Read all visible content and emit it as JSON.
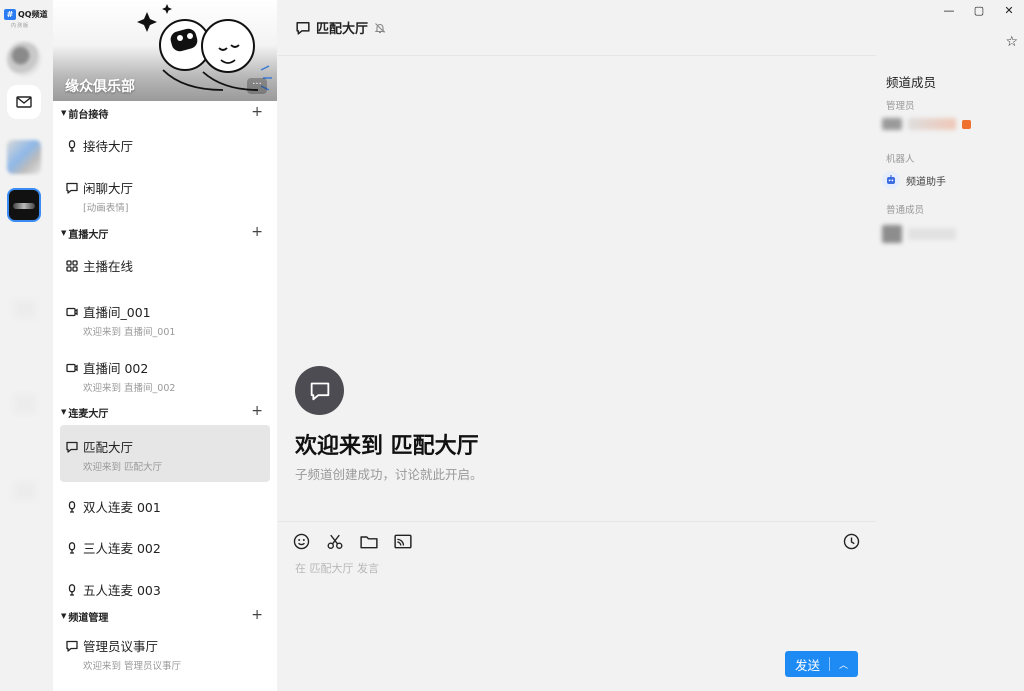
{
  "rail": {
    "logo_text": "QQ频道",
    "logo_sub": "内测版"
  },
  "guild": {
    "name": "缘众俱乐部",
    "more_label": "···"
  },
  "categories": [
    {
      "name": "前台接待",
      "channels": [
        {
          "name": "接待大厅",
          "icon": "microphone-icon"
        },
        {
          "name": "闲聊大厅",
          "icon": "chat-bubble-icon",
          "sub": "[动画表情]"
        }
      ]
    },
    {
      "name": "直播大厅",
      "channels": [
        {
          "name": "主播在线",
          "icon": "grid-icon"
        },
        {
          "name": "直播间_001",
          "icon": "video-icon",
          "sub": "欢迎来到 直播间_001"
        },
        {
          "name": "直播间 002",
          "icon": "video-icon",
          "sub": "欢迎来到 直播间_002"
        }
      ]
    },
    {
      "name": "连麦大厅",
      "channels": [
        {
          "name": "匹配大厅",
          "icon": "chat-bubble-icon",
          "sub": "欢迎来到 匹配大厅",
          "active": true
        },
        {
          "name": "双人连麦 001",
          "icon": "microphone-icon"
        },
        {
          "name": "三人连麦 002",
          "icon": "microphone-icon"
        },
        {
          "name": "五人连麦 003",
          "icon": "microphone-icon"
        }
      ]
    },
    {
      "name": "频道管理",
      "channels": [
        {
          "name": "管理员议事厅",
          "icon": "chat-bubble-icon",
          "sub": "欢迎来到 管理员议事厅"
        }
      ]
    }
  ],
  "main": {
    "title": "匹配大厅",
    "welcome_title": "欢迎来到 匹配大厅",
    "welcome_sub": "子频道创建成功，讨论就此开启。",
    "input_placeholder": "在 匹配大厅 发言",
    "send_label": "发送"
  },
  "members": {
    "title": "频道成员",
    "groups": {
      "admin": "管理员",
      "bot": "机器人",
      "normal": "普通成员"
    },
    "bot_name": "频道助手"
  },
  "colors": {
    "accent": "#1e8bf5",
    "active_channel_bg": "#e6e6e6",
    "welcome_icon_bg": "#4c4c52"
  }
}
